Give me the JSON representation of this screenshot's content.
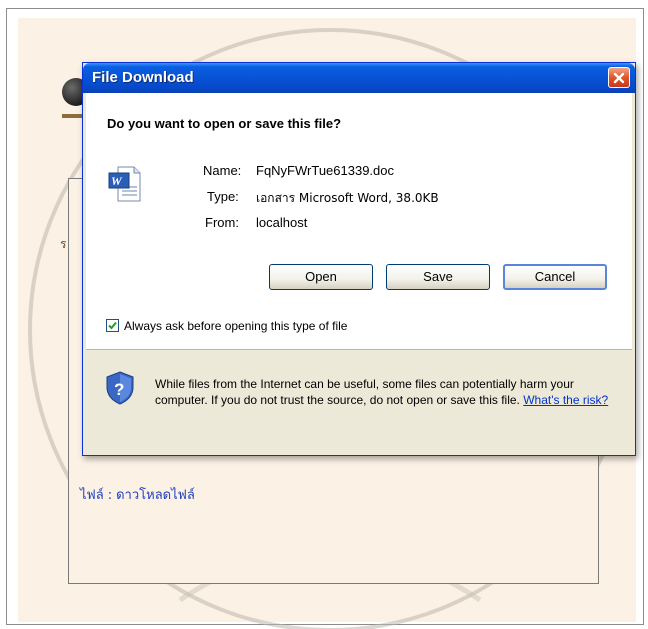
{
  "dialog": {
    "title": "File Download",
    "question": "Do you want to open or save this file?",
    "file_icon": "word-document-icon",
    "name_label": "Name:",
    "name_value": "FqNyFWrTue61339.doc",
    "type_label": "Type:",
    "type_value": "เอกสาร Microsoft Word, 38.0KB",
    "from_label": "From:",
    "from_value": "localhost",
    "buttons": {
      "open": "Open",
      "save": "Save",
      "cancel": "Cancel"
    },
    "checkbox_label": "Always ask before opening this type of file",
    "checkbox_checked": true,
    "warning_icon": "security-shield-question-icon",
    "warning_text": "While files from the Internet can be useful, some files can potentially harm your computer. If you do not trust the source, do not open or save this file.",
    "risk_link": "What's the risk?"
  },
  "page": {
    "left_char": "ร",
    "file_label": "ไฟล์",
    "file_separator": ":",
    "file_link": "ดาวโหลดไฟล์"
  },
  "colors": {
    "titlebar": "#0753d6",
    "dialog_bg": "#ece9d8",
    "page_bg": "#fbf1e4",
    "link": "#1f3fbf",
    "close_button": "#e0552a"
  }
}
